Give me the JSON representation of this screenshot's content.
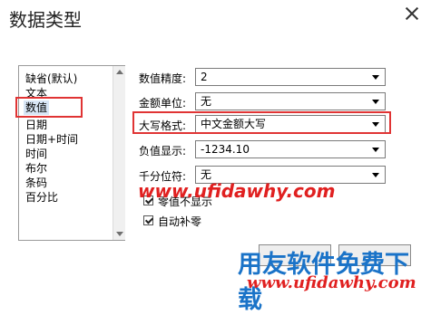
{
  "dialog": {
    "title": "数据类型"
  },
  "types": {
    "items": [
      "缺省(默认)",
      "文本",
      "数值",
      "日期",
      "日期+时间",
      "时间",
      "布尔",
      "条码",
      "百分比"
    ],
    "selected": "数值"
  },
  "settings": {
    "precision": {
      "label": "数值精度:",
      "value": "2"
    },
    "currency_unit": {
      "label": "金额单位:",
      "value": "无"
    },
    "uppercase_format": {
      "label": "大写格式:",
      "value": "中文金额大写"
    },
    "negative_display": {
      "label": "负值显示:",
      "value": "-1234.10"
    },
    "thousands_sep": {
      "label": "千分位符:",
      "value": "无"
    },
    "hide_zero": {
      "label": "零值不显示",
      "checked": true
    },
    "auto_pad_zero": {
      "label": "自动补零",
      "checked": true
    }
  },
  "watermarks": {
    "url_mid": "www.ufidawhy.com",
    "brand": "用友软件免费下载",
    "url_bottom": "www.ufidawhy.com"
  },
  "colors": {
    "highlight_box": "#e03434",
    "brand_blue": "#1a73c8",
    "watermark_red": "#e02020"
  }
}
